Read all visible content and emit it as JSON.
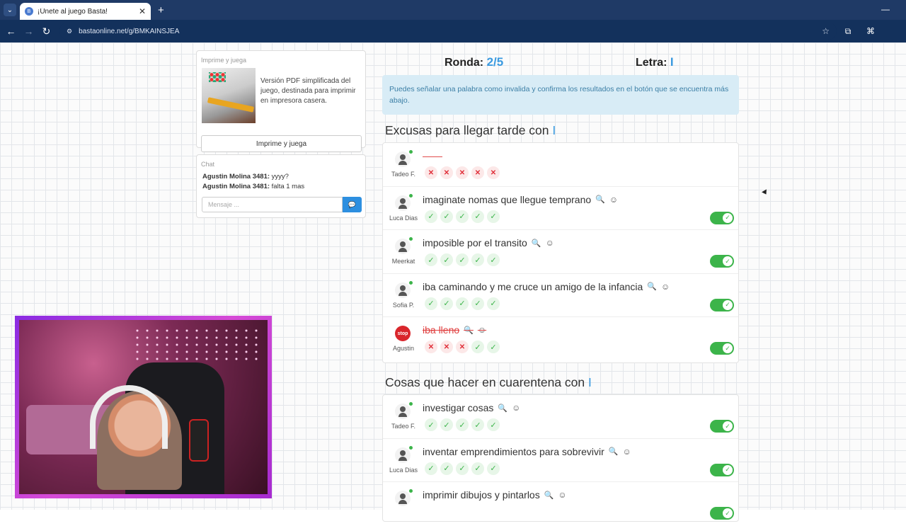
{
  "browser": {
    "tab_title": "¡Únete al juego Basta!",
    "url": "bastaonline.net/g/BMKAINSJEA"
  },
  "print_card": {
    "heading": "Imprime y juega",
    "description": "Versión PDF simplificada del juego, destinada para imprimir en impresora casera.",
    "button": "Imprime y juega"
  },
  "chat": {
    "heading": "Chat",
    "messages": [
      {
        "user": "Agustin Molina 3481:",
        "text": " yyyy?"
      },
      {
        "user": "Agustin Molina 3481:",
        "text": " falta 1 mas"
      }
    ],
    "placeholder": "Mensaje ..."
  },
  "game": {
    "ronda_label": "Ronda:",
    "ronda_value": "2/5",
    "letra_label": "Letra:",
    "letra_value": "I",
    "info": "Puedes señalar una palabra como invalida y confirma los resultados en el botón que se encuentra más abajo."
  },
  "categories": [
    {
      "title": "Excusas para llegar tarde con ",
      "letter": "I",
      "answers": [
        {
          "user": "Tadeo F.",
          "word": "——",
          "state": "empty",
          "votes": [
            "no",
            "no",
            "no",
            "no",
            "no"
          ],
          "toggle": false
        },
        {
          "user": "Luca Dias",
          "word": "imaginate nomas que llegue temprano",
          "state": "ok",
          "votes": [
            "ok",
            "ok",
            "ok",
            "ok",
            "ok"
          ],
          "toggle": true
        },
        {
          "user": "Meerkat",
          "word": "imposible por el transito",
          "state": "ok",
          "votes": [
            "ok",
            "ok",
            "ok",
            "ok",
            "ok"
          ],
          "toggle": true
        },
        {
          "user": "Sofia P.",
          "word": "iba caminando y me cruce un amigo de la infancia",
          "state": "ok",
          "votes": [
            "ok",
            "ok",
            "ok",
            "ok",
            "ok"
          ],
          "toggle": true
        },
        {
          "user": "Agustin",
          "word": "iba lleno",
          "state": "bad",
          "votes": [
            "no",
            "no",
            "no",
            "ok",
            "ok"
          ],
          "toggle": true,
          "stop": true
        }
      ]
    },
    {
      "title": "Cosas que hacer en cuarentena con ",
      "letter": "I",
      "answers": [
        {
          "user": "Tadeo F.",
          "word": "investigar cosas",
          "state": "ok",
          "votes": [
            "ok",
            "ok",
            "ok",
            "ok",
            "ok"
          ],
          "toggle": true
        },
        {
          "user": "Luca Dias",
          "word": "inventar emprendimientos para sobrevivir",
          "state": "ok",
          "votes": [
            "ok",
            "ok",
            "ok",
            "ok",
            "ok"
          ],
          "toggle": true
        },
        {
          "user": "",
          "word": "imprimir dibujos y pintarlos",
          "state": "ok",
          "votes": [],
          "toggle": true
        }
      ]
    }
  ],
  "avatar_stop_text": "stop"
}
